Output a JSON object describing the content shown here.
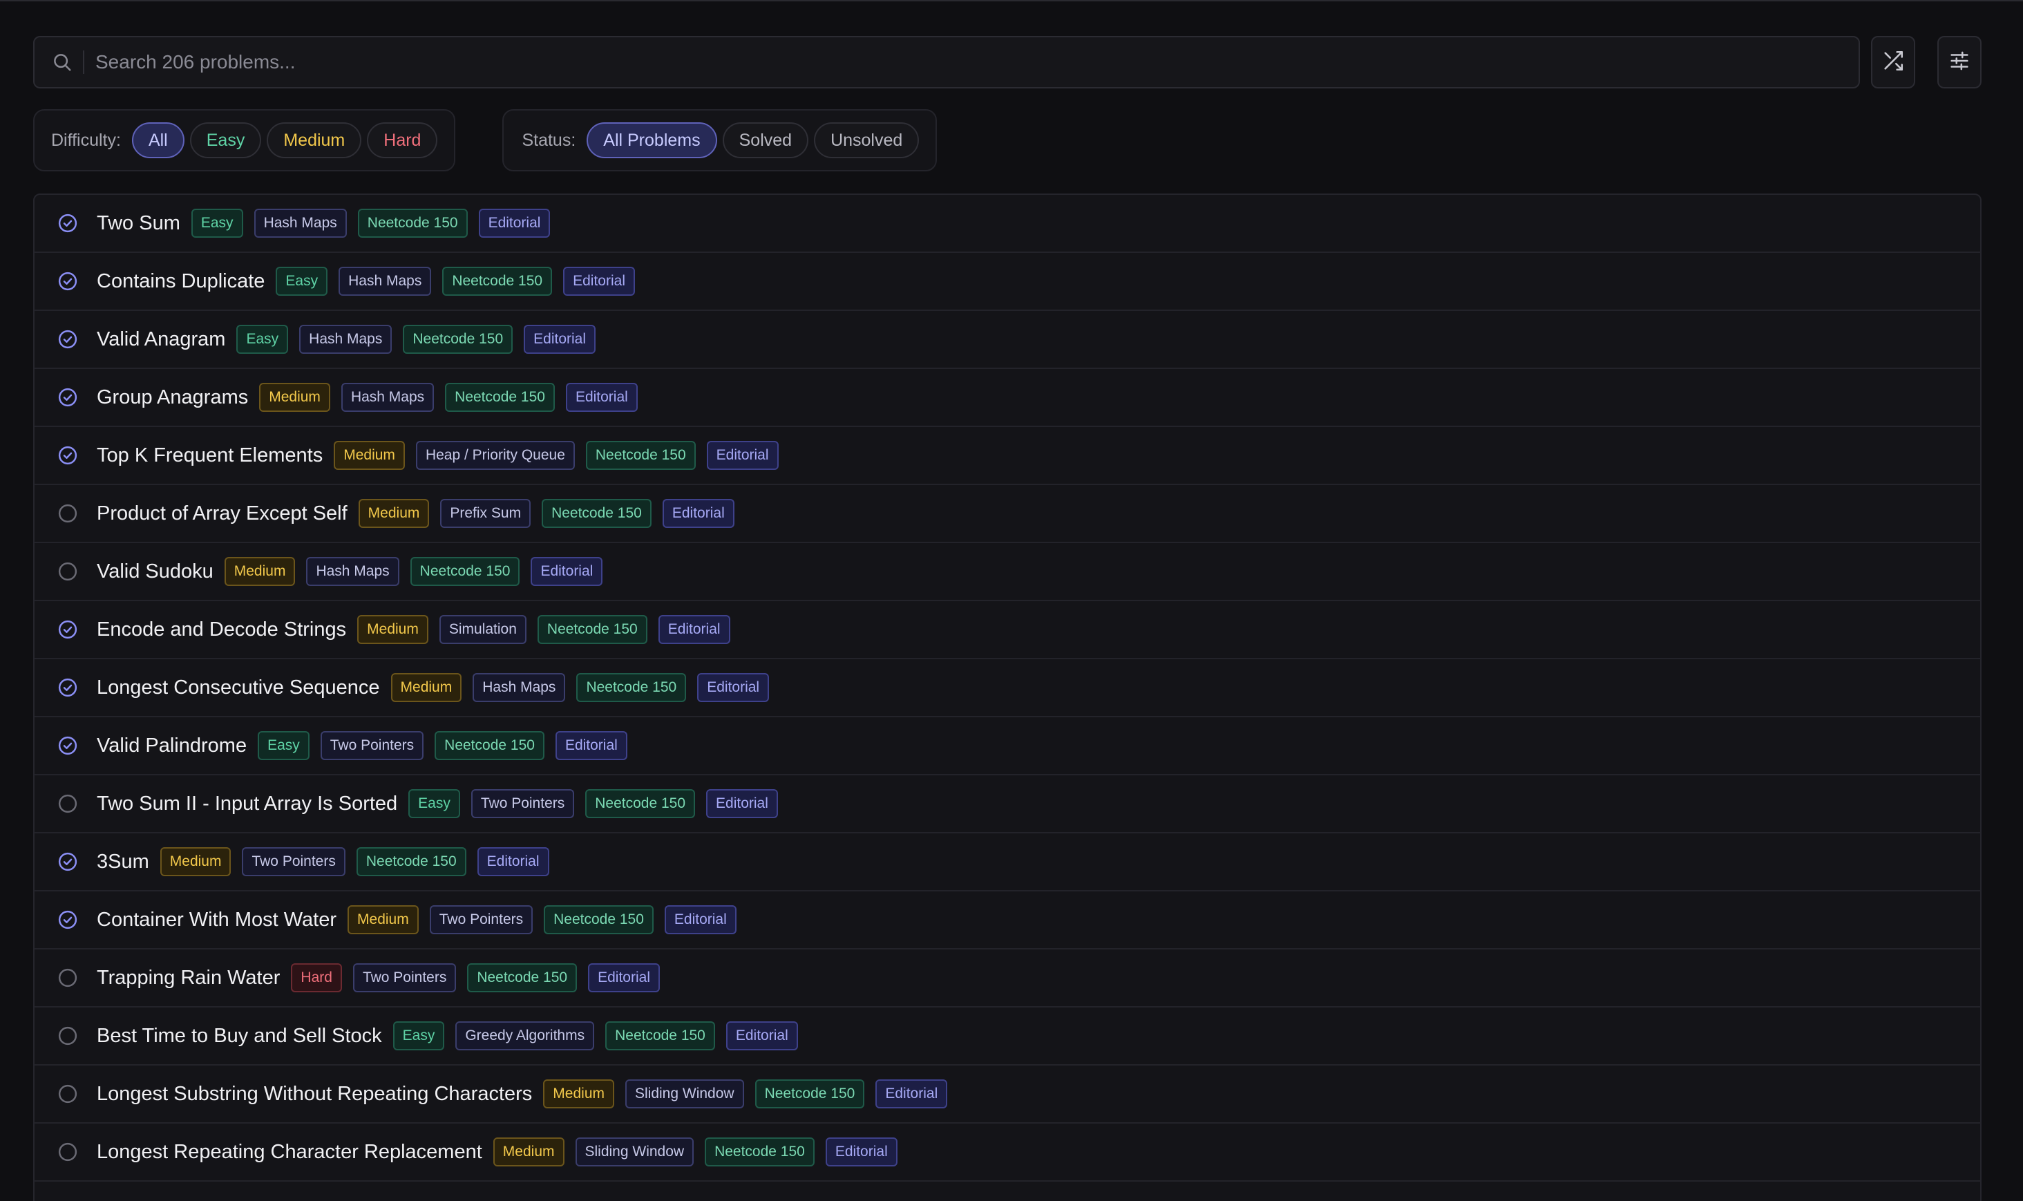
{
  "search": {
    "placeholder": "Search 206 problems..."
  },
  "toolbar": {
    "shuffle_icon": "shuffle-icon",
    "settings_icon": "sliders-icon"
  },
  "filters": {
    "difficulty": {
      "label": "Difficulty:",
      "options": [
        "All",
        "Easy",
        "Medium",
        "Hard"
      ],
      "selected": "All"
    },
    "status": {
      "label": "Status:",
      "options": [
        "All Problems",
        "Solved",
        "Unsolved"
      ],
      "selected": "All Problems"
    }
  },
  "colors": {
    "accent": "#7c80f0",
    "easy": "#5fd3a6",
    "medium": "#f2c84b",
    "hard": "#ef6f7b"
  },
  "problems": [
    {
      "title": "Two Sum",
      "solved": true,
      "difficulty": "Easy",
      "topic": "Hash Maps",
      "list": "Neetcode 150",
      "editorial": "Editorial"
    },
    {
      "title": "Contains Duplicate",
      "solved": true,
      "difficulty": "Easy",
      "topic": "Hash Maps",
      "list": "Neetcode 150",
      "editorial": "Editorial"
    },
    {
      "title": "Valid Anagram",
      "solved": true,
      "difficulty": "Easy",
      "topic": "Hash Maps",
      "list": "Neetcode 150",
      "editorial": "Editorial"
    },
    {
      "title": "Group Anagrams",
      "solved": true,
      "difficulty": "Medium",
      "topic": "Hash Maps",
      "list": "Neetcode 150",
      "editorial": "Editorial"
    },
    {
      "title": "Top K Frequent Elements",
      "solved": true,
      "difficulty": "Medium",
      "topic": "Heap / Priority Queue",
      "list": "Neetcode 150",
      "editorial": "Editorial"
    },
    {
      "title": "Product of Array Except Self",
      "solved": false,
      "difficulty": "Medium",
      "topic": "Prefix Sum",
      "list": "Neetcode 150",
      "editorial": "Editorial"
    },
    {
      "title": "Valid Sudoku",
      "solved": false,
      "difficulty": "Medium",
      "topic": "Hash Maps",
      "list": "Neetcode 150",
      "editorial": "Editorial"
    },
    {
      "title": "Encode and Decode Strings",
      "solved": true,
      "difficulty": "Medium",
      "topic": "Simulation",
      "list": "Neetcode 150",
      "editorial": "Editorial"
    },
    {
      "title": "Longest Consecutive Sequence",
      "solved": true,
      "difficulty": "Medium",
      "topic": "Hash Maps",
      "list": "Neetcode 150",
      "editorial": "Editorial"
    },
    {
      "title": "Valid Palindrome",
      "solved": true,
      "difficulty": "Easy",
      "topic": "Two Pointers",
      "list": "Neetcode 150",
      "editorial": "Editorial"
    },
    {
      "title": "Two Sum II - Input Array Is Sorted",
      "solved": false,
      "difficulty": "Easy",
      "topic": "Two Pointers",
      "list": "Neetcode 150",
      "editorial": "Editorial"
    },
    {
      "title": "3Sum",
      "solved": true,
      "difficulty": "Medium",
      "topic": "Two Pointers",
      "list": "Neetcode 150",
      "editorial": "Editorial"
    },
    {
      "title": "Container With Most Water",
      "solved": true,
      "difficulty": "Medium",
      "topic": "Two Pointers",
      "list": "Neetcode 150",
      "editorial": "Editorial"
    },
    {
      "title": "Trapping Rain Water",
      "solved": false,
      "difficulty": "Hard",
      "topic": "Two Pointers",
      "list": "Neetcode 150",
      "editorial": "Editorial"
    },
    {
      "title": "Best Time to Buy and Sell Stock",
      "solved": false,
      "difficulty": "Easy",
      "topic": "Greedy Algorithms",
      "list": "Neetcode 150",
      "editorial": "Editorial"
    },
    {
      "title": "Longest Substring Without Repeating Characters",
      "solved": false,
      "difficulty": "Medium",
      "topic": "Sliding Window",
      "list": "Neetcode 150",
      "editorial": "Editorial"
    },
    {
      "title": "Longest Repeating Character Replacement",
      "solved": false,
      "difficulty": "Medium",
      "topic": "Sliding Window",
      "list": "Neetcode 150",
      "editorial": "Editorial"
    }
  ]
}
